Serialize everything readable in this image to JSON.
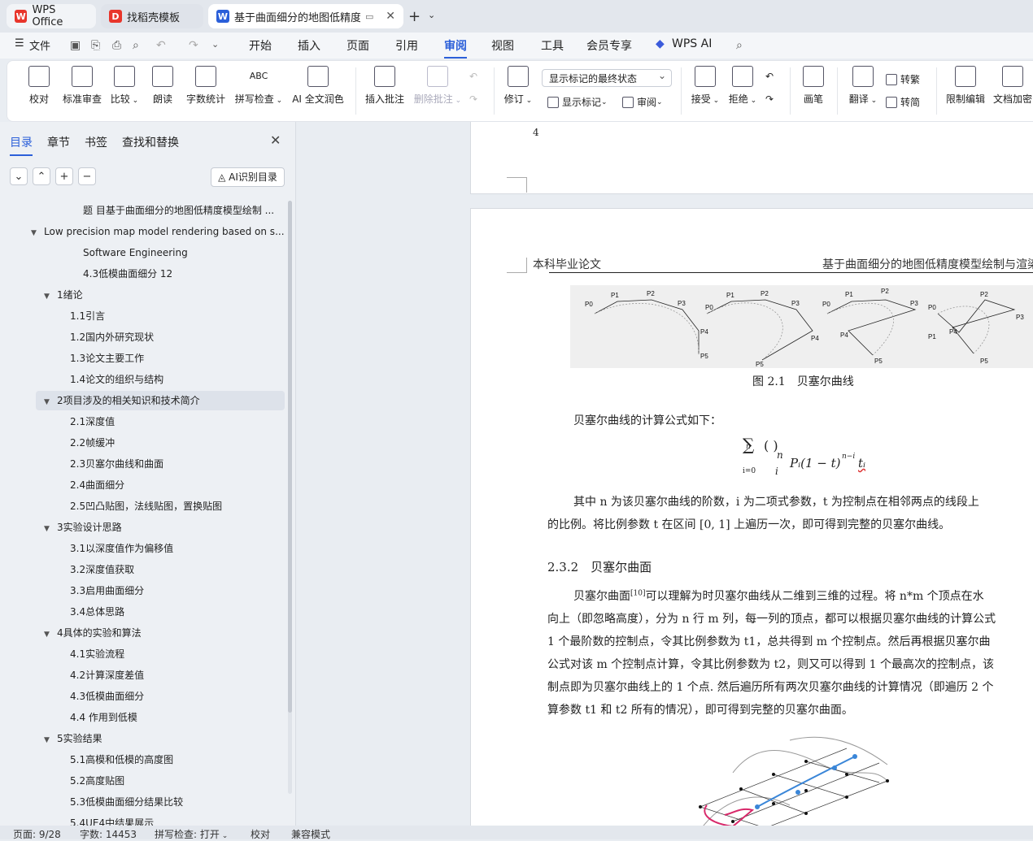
{
  "tabs": {
    "wps": "WPS Office",
    "templates": "找稻壳模板",
    "document": "基于曲面细分的地图低精度模"
  },
  "menu": {
    "file": "文件",
    "items": [
      "开始",
      "插入",
      "页面",
      "引用",
      "审阅",
      "视图",
      "工具",
      "会员专享"
    ],
    "active": "审阅",
    "wps_ai": "WPS AI"
  },
  "ribbon": {
    "proofread": "校对",
    "standard_review": "标准审查",
    "compare": "比较",
    "read_aloud": "朗读",
    "word_count": "字数统计",
    "spell_check": "拼写检查",
    "ai_polish": "AI 全文润色",
    "insert_comment": "插入批注",
    "delete_comment": "删除批注",
    "revise": "修订",
    "markup_select": "显示标记的最终状态",
    "show_markup": "显示标记",
    "review": "审阅",
    "accept": "接受",
    "reject": "拒绝",
    "pen": "画笔",
    "translate": "翻译",
    "to_traditional": "转繁",
    "to_simplified": "转简",
    "restrict_edit": "限制编辑",
    "encrypt": "文档加密"
  },
  "nav": {
    "tabs": [
      "目录",
      "章节",
      "书签",
      "查找和替换"
    ],
    "ai_toc": "AI识别目录",
    "toc": [
      {
        "label": "题 目基于曲面细分的地图低精度模型绘制 ...",
        "level": 3,
        "arrow": ""
      },
      {
        "label": "Low precision map model rendering based on s...",
        "level": 0,
        "arrow": "▼"
      },
      {
        "label": "Software Engineering",
        "level": 3,
        "arrow": ""
      },
      {
        "label": "4.3低模曲面细分 12",
        "level": 3,
        "arrow": ""
      },
      {
        "label": "1绪论",
        "level": 1,
        "arrow": "▼"
      },
      {
        "label": "1.1引言",
        "level": 2,
        "arrow": ""
      },
      {
        "label": "1.2国内外研究现状",
        "level": 2,
        "arrow": ""
      },
      {
        "label": "1.3论文主要工作",
        "level": 2,
        "arrow": ""
      },
      {
        "label": "1.4论文的组织与结构",
        "level": 2,
        "arrow": ""
      },
      {
        "label": "2项目涉及的相关知识和技术简介",
        "level": 1,
        "arrow": "▼",
        "selected": true
      },
      {
        "label": "2.1深度值",
        "level": 2,
        "arrow": ""
      },
      {
        "label": "2.2帧缓冲",
        "level": 2,
        "arrow": ""
      },
      {
        "label": "2.3贝塞尔曲线和曲面",
        "level": 2,
        "arrow": ""
      },
      {
        "label": "2.4曲面细分",
        "level": 2,
        "arrow": ""
      },
      {
        "label": "2.5凹凸贴图，法线贴图，置换贴图",
        "level": 2,
        "arrow": ""
      },
      {
        "label": "3实验设计思路",
        "level": 1,
        "arrow": "▼"
      },
      {
        "label": "3.1以深度值作为偏移值",
        "level": 2,
        "arrow": ""
      },
      {
        "label": "3.2深度值获取",
        "level": 2,
        "arrow": ""
      },
      {
        "label": "3.3启用曲面细分",
        "level": 2,
        "arrow": ""
      },
      {
        "label": "3.4总体思路",
        "level": 2,
        "arrow": ""
      },
      {
        "label": "4具体的实验和算法",
        "level": 1,
        "arrow": "▼"
      },
      {
        "label": "4.1实验流程",
        "level": 2,
        "arrow": ""
      },
      {
        "label": "4.2计算深度差值",
        "level": 2,
        "arrow": ""
      },
      {
        "label": "4.3低模曲面细分",
        "level": 2,
        "arrow": ""
      },
      {
        "label": "4.4 作用到低模",
        "level": 2,
        "arrow": ""
      },
      {
        "label": "5实验结果",
        "level": 1,
        "arrow": "▼"
      },
      {
        "label": "5.1高模和低模的高度图",
        "level": 2,
        "arrow": ""
      },
      {
        "label": "5.2高度贴图",
        "level": 2,
        "arrow": ""
      },
      {
        "label": "5.3低模曲面细分结果比较",
        "level": 2,
        "arrow": ""
      },
      {
        "label": "5.4UE4中结果展示",
        "level": 2,
        "arrow": ""
      }
    ]
  },
  "document": {
    "page1_number": "4",
    "header_left": "本科毕业论文",
    "header_right": "基于曲面细分的地图低精度模型绘制与渲染",
    "figure1_caption": "图 2.1　贝塞尔曲线",
    "figure1_labels": [
      "P0",
      "P1",
      "P2",
      "P3",
      "P4",
      "P5"
    ],
    "formula_intro": "贝塞尔曲线的计算公式如下：",
    "formula": {
      "sum": "∑",
      "sum_top": "n",
      "sum_bottom": "i=0",
      "binom_top": "n",
      "binom_bottom": "i",
      "term": "Pᵢ(1 − t)",
      "exp": "n−i",
      "tail": "tᵢ"
    },
    "para1_line1": "其中 n 为该贝塞尔曲线的阶数，i 为二项式参数，t 为控制点在相邻两点的线段上",
    "para1_line2": "的比例。将比例参数 t 在区间 [0, 1] 上遍历一次，即可得到完整的贝塞尔曲线。",
    "subheading": "2.3.2　贝塞尔曲面",
    "para2_lines": [
      "贝塞尔曲面",
      "[10]",
      "可以理解为时贝塞尔曲线从二维到三维的过程。将 n*m 个顶点在水",
      "向上（即忽略高度），分为 n 行 m 列，每一列的顶点，都可以根据贝塞尔曲线的计算公式",
      "1 个最阶数的控制点，令其比例参数为 t1，总共得到 m 个控制点。然后再根据贝塞尔曲",
      "公式对该 m 个控制点计算，令其比例参数为 t2，则又可以得到 1 个最高次的控制点，该",
      "制点即为贝塞尔曲线上的 1 个点. 然后遍历所有两次贝塞尔曲线的计算情况（即遍历 2 个",
      "算参数 t1 和 t2 所有的情况），即可得到完整的贝塞尔曲面。"
    ]
  },
  "status": {
    "page": "页面: 9/28",
    "words": "字数: 14453",
    "spell": "拼写检查: 打开",
    "proof": "校对",
    "compat": "兼容模式"
  },
  "colors": {
    "accent": "#2b5fd9",
    "doc_tab_icon": "#2b5fd9",
    "wps_icon": "#e8352b",
    "tpl_icon": "#e8352b"
  }
}
